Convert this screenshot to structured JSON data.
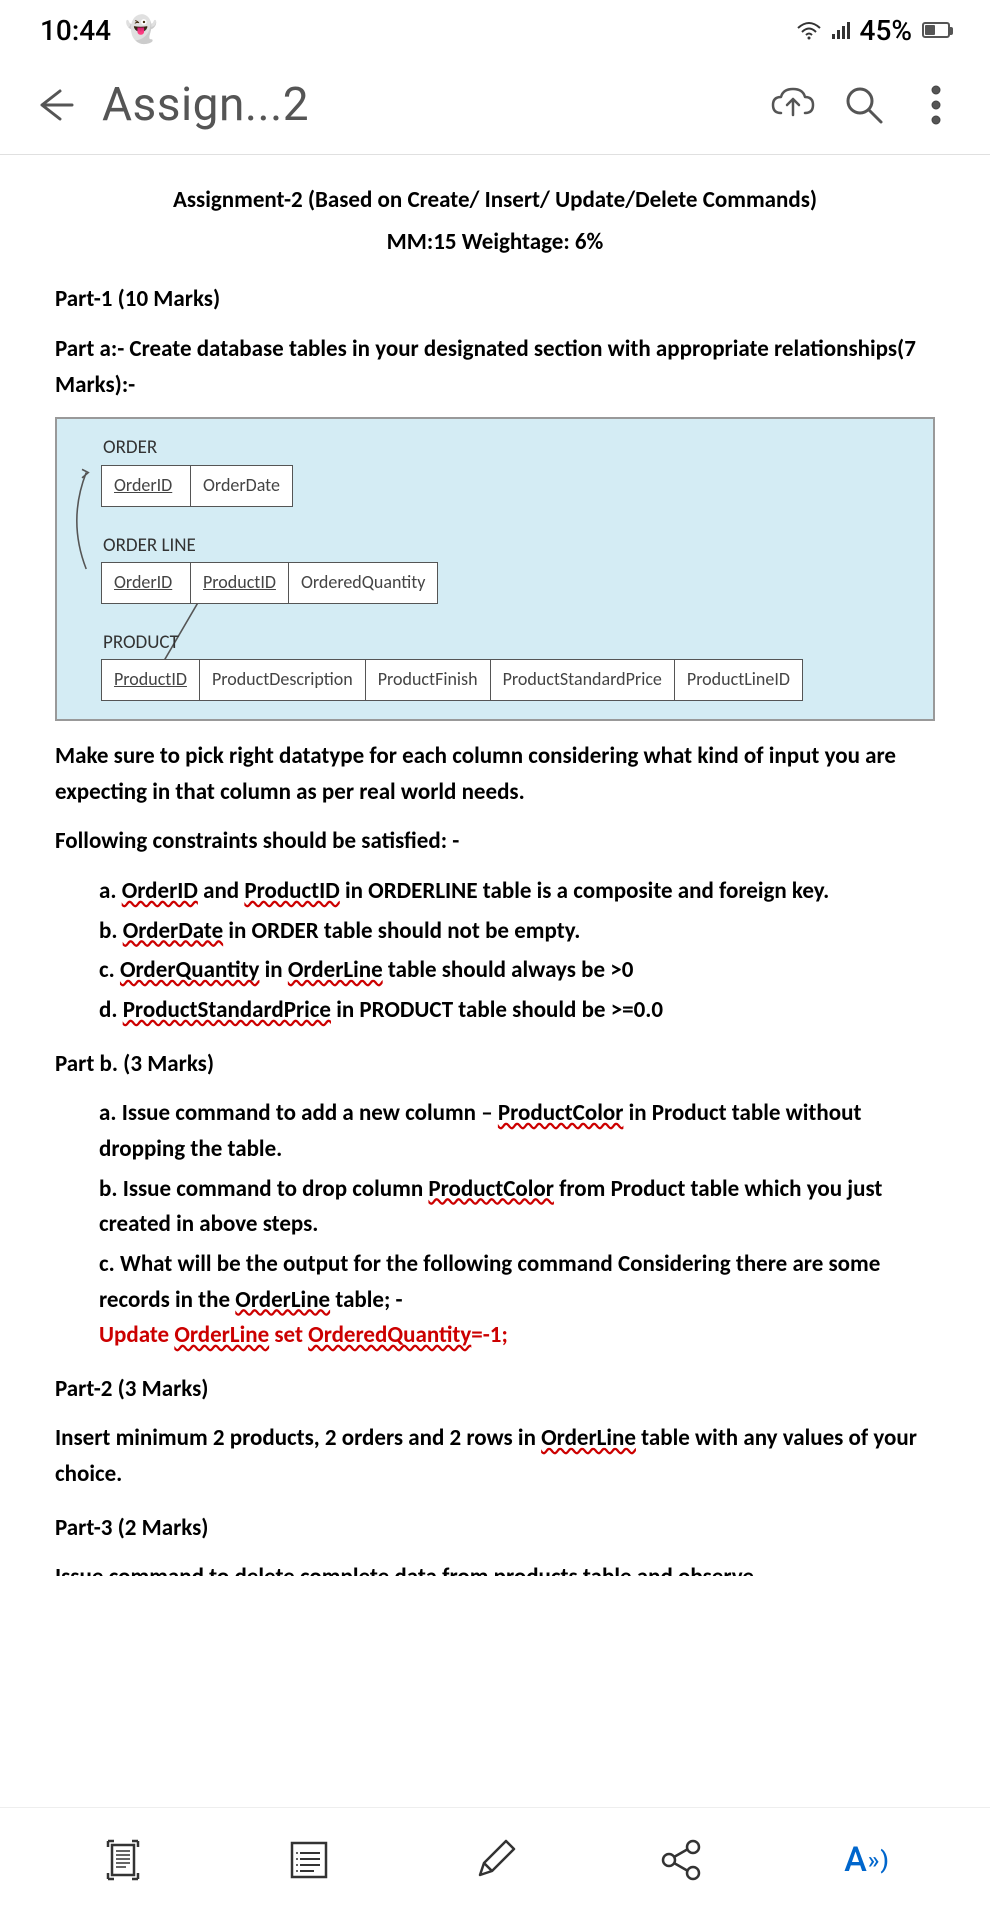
{
  "status": {
    "time": "10:44",
    "battery": "45%"
  },
  "header": {
    "title": "Assign...2"
  },
  "doc": {
    "title": "Assignment-2 (Based on Create/ Insert/ Update/Delete Commands)",
    "subtitle": "MM:15        Weightage: 6%",
    "part1_heading": "Part-1 (10 Marks)",
    "part_a_intro": "Part a:- Create database tables in your designated section with appropriate relationships(7 Marks):-",
    "erd": {
      "order": {
        "label": "ORDER",
        "cols": [
          "OrderID",
          "OrderDate"
        ]
      },
      "orderline": {
        "label": "ORDER LINE",
        "cols": [
          "OrderID",
          "ProductID",
          "OrderedQuantity"
        ]
      },
      "product": {
        "label": "PRODUCT",
        "cols": [
          "ProductID",
          "ProductDescription",
          "ProductFinish",
          "ProductStandardPrice",
          "ProductLineID"
        ]
      }
    },
    "datatype_note": "Make sure to pick right datatype for each column considering what kind of input you are expecting in that column as per real world needs.",
    "constraints_intro": "Following constraints should be satisfied: -",
    "constraints": {
      "a_pre": "",
      "a_u1": "OrderID",
      "a_mid": " and ",
      "a_u2": "ProductID",
      "a_post": " in ORDERLINE table is a composite and foreign key.",
      "b_u": "OrderDate",
      "b_post": " in ORDER table should not be empty.",
      "c_u1": "OrderQuantity",
      "c_mid": " in ",
      "c_u2": "OrderLine",
      "c_post": " table should always be >0",
      "d_u": "ProductStandardPrice",
      "d_post": " in PRODUCT table should be >=0.0"
    },
    "part_b_heading": "Part b. (3 Marks)",
    "partb": {
      "a_pre": "Issue command to add a new column – ",
      "a_u": "ProductColor",
      "a_post": " in Product table without dropping the table.",
      "b_pre": "Issue command to drop column ",
      "b_u": "ProductColor",
      "b_post": " from Product table which you just created in above steps.",
      "c_pre": "What will be the output for the following command Considering there are some records in the ",
      "c_u": "OrderLine",
      "c_post": " table; -",
      "c_cmd_pre": "Update ",
      "c_cmd_u1": "OrderLine",
      "c_cmd_mid": " set ",
      "c_cmd_u2": "OrderedQuantity",
      "c_cmd_post": "=-1;"
    },
    "part2_heading": "Part-2 (3 Marks)",
    "part2_body_pre": "Insert minimum 2 products, 2 orders and 2 rows in ",
    "part2_body_u": "OrderLine",
    "part2_body_post": " table with any values of your choice.",
    "part3_heading": "Part-3 (2 Marks)",
    "cutoff_line": "Issue command to delete complete data from products table and observe"
  }
}
